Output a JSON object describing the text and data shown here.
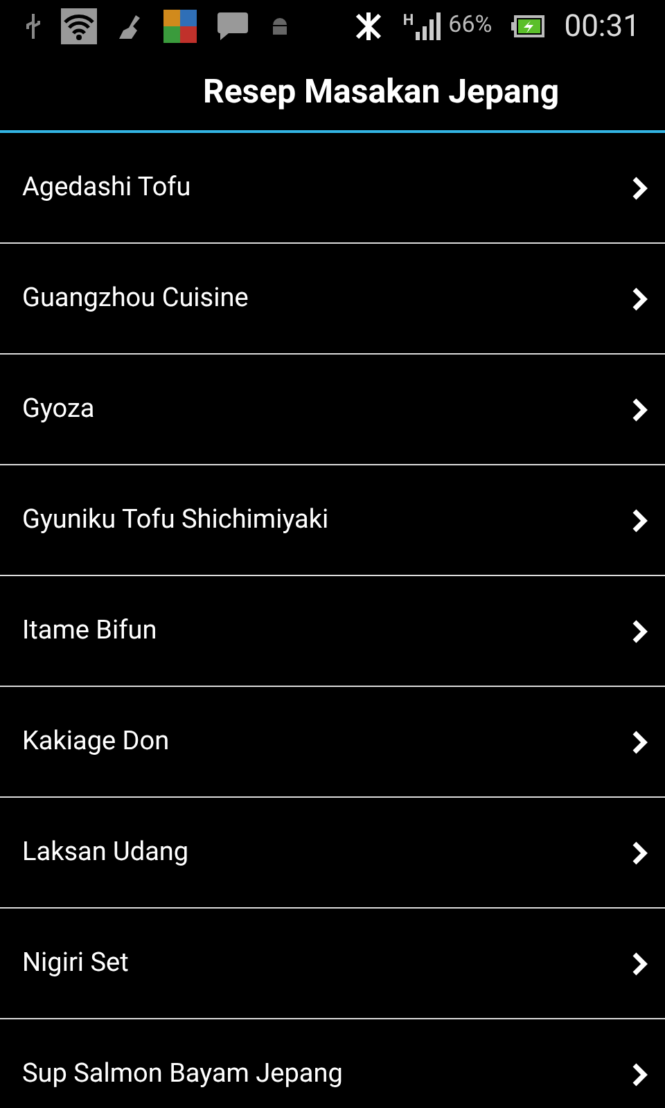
{
  "status_bar": {
    "network_type": "H",
    "battery": "66%",
    "time": "00:31"
  },
  "title": "Resep Masakan Jepang",
  "items": [
    {
      "label": "Agedashi Tofu"
    },
    {
      "label": "Guangzhou Cuisine"
    },
    {
      "label": "Gyoza"
    },
    {
      "label": "Gyuniku Tofu Shichimiyaki"
    },
    {
      "label": "Itame Bifun"
    },
    {
      "label": "Kakiage Don"
    },
    {
      "label": "Laksan Udang"
    },
    {
      "label": "Nigiri Set"
    },
    {
      "label": "Sup Salmon Bayam Jepang"
    }
  ]
}
